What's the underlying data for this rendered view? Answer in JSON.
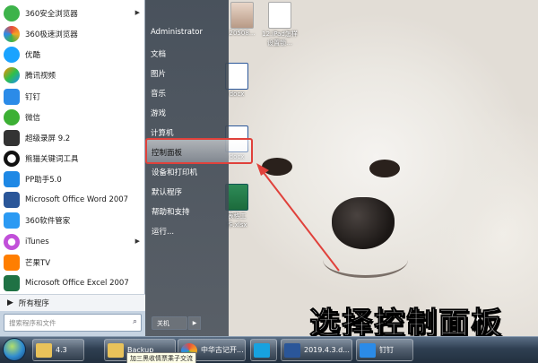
{
  "start_menu": {
    "programs": [
      {
        "label": "360安全浏览器",
        "icon": "360-safe-browser-icon",
        "color": "#3db34a",
        "has_submenu": true
      },
      {
        "label": "360极速浏览器",
        "icon": "360-speed-browser-icon",
        "color": "#e84c3d",
        "has_submenu": false
      },
      {
        "label": "优酷",
        "icon": "youku-icon",
        "color": "#1aa3ff",
        "has_submenu": false
      },
      {
        "label": "腾讯视频",
        "icon": "tencent-video-icon",
        "color": "#ff8a00",
        "has_submenu": false
      },
      {
        "label": "钉钉",
        "icon": "dingtalk-icon",
        "color": "#2b8be8",
        "has_submenu": false
      },
      {
        "label": "微信",
        "icon": "wechat-icon",
        "color": "#3cb034",
        "has_submenu": false
      },
      {
        "label": "超级录屏 9.2",
        "icon": "super-recorder-icon",
        "color": "#333333",
        "has_submenu": false
      },
      {
        "label": "熊猫关键词工具",
        "icon": "panda-keyword-icon",
        "color": "#111111",
        "has_submenu": false
      },
      {
        "label": "PP助手5.0",
        "icon": "pp-assistant-icon",
        "color": "#1e88e5",
        "has_submenu": false
      },
      {
        "label": "Microsoft Office Word 2007",
        "icon": "word-icon",
        "color": "#2a5699",
        "has_submenu": false
      },
      {
        "label": "360软件管家",
        "icon": "360-software-manager-icon",
        "color": "#2b9af3",
        "has_submenu": false
      },
      {
        "label": "iTunes",
        "icon": "itunes-icon",
        "color": "#c14fd9",
        "has_submenu": true
      },
      {
        "label": "芒果TV",
        "icon": "mango-tv-icon",
        "color": "#ff7e00",
        "has_submenu": false
      },
      {
        "label": "Microsoft Office Excel 2007",
        "icon": "excel-icon",
        "color": "#1f7244",
        "has_submenu": false
      }
    ],
    "all_programs": "所有程序",
    "search_placeholder": "搜索程序和文件",
    "right_items": [
      {
        "label": "Administrator",
        "has_submenu": false
      },
      {
        "label": "文档",
        "has_submenu": false
      },
      {
        "label": "图片",
        "has_submenu": false
      },
      {
        "label": "音乐",
        "has_submenu": false
      },
      {
        "label": "游戏",
        "has_submenu": false
      },
      {
        "label": "计算机",
        "has_submenu": false
      },
      {
        "label": "控制面板",
        "has_submenu": false
      },
      {
        "label": "设备和打印机",
        "has_submenu": false
      },
      {
        "label": "默认程序",
        "has_submenu": false
      },
      {
        "label": "帮助和支持",
        "has_submenu": false
      },
      {
        "label": "运行...",
        "has_submenu": false
      }
    ],
    "shutdown_label": "关机"
  },
  "desktop_icons": [
    {
      "label": "20508...",
      "icon": "image-file-icon"
    },
    {
      "label": "12.iPad怎样设置锁...",
      "icon": "document-icon"
    },
    {
      "label": "docx",
      "icon": "word-document-icon"
    },
    {
      "label": "docx",
      "icon": "word-document-icon"
    },
    {
      "label": "表格工作.xlsx",
      "icon": "excel-document-icon"
    }
  ],
  "subtitle": "选择控制面板",
  "taskbar": {
    "items": [
      {
        "label": "4.3",
        "icon": "folder-icon",
        "color": "#e8c25a"
      },
      {
        "label": "Backup",
        "icon": "folder-icon",
        "color": "#e8c25a"
      },
      {
        "label": "中华古记开...",
        "icon": "browser-icon",
        "color": "#3b8fe0"
      },
      {
        "label": "",
        "icon": "video-player-icon",
        "color": "#17a2e0"
      },
      {
        "label": "2019.4.3.d...",
        "icon": "word-document-icon",
        "color": "#2a5699"
      },
      {
        "label": "钉钉",
        "icon": "dingtalk-icon",
        "color": "#2b8be8"
      }
    ],
    "tooltip": "加三黑收情票乘子交流"
  },
  "colors": {
    "highlight_border": "#e0413b",
    "arrow": "#e0413b"
  }
}
